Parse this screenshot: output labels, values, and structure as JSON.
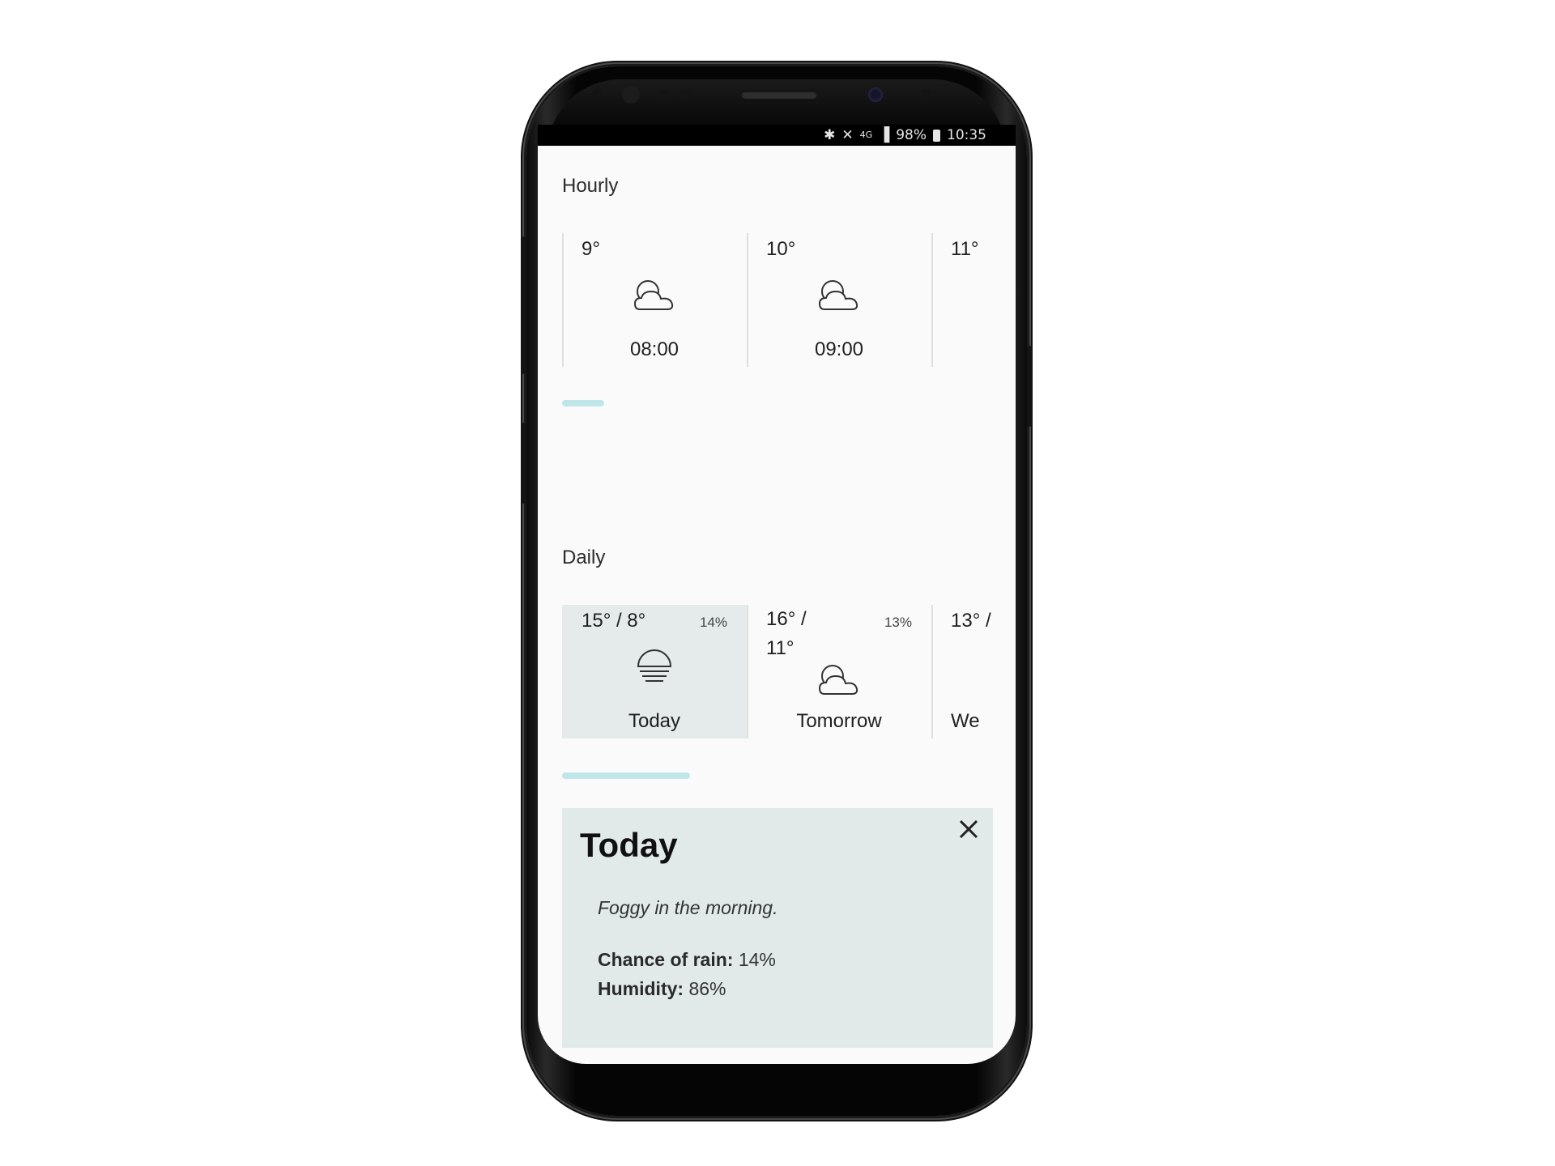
{
  "status_bar": {
    "icons": [
      "bluetooth-icon",
      "mute-icon",
      "4g-icon",
      "signal-icon"
    ],
    "battery": "98%",
    "time": "10:35"
  },
  "hourly": {
    "title": "Hourly",
    "items": [
      {
        "temp": "9°",
        "time": "08:00",
        "icon": "partly-cloudy-icon"
      },
      {
        "temp": "10°",
        "time": "09:00",
        "icon": "partly-cloudy-icon"
      },
      {
        "temp": "11°",
        "time": "",
        "icon": ""
      }
    ],
    "scroll_position": 0.0
  },
  "daily": {
    "title": "Daily",
    "items": [
      {
        "temp": "15° / 8°",
        "rain": "14%",
        "label": "Today",
        "icon": "fog-icon",
        "selected": true
      },
      {
        "temp": "16° /\n11°",
        "rain": "13%",
        "label": "Tomorrow",
        "icon": "partly-cloudy-icon",
        "selected": false
      },
      {
        "temp": "13° /",
        "rain": "",
        "label": "We",
        "icon": "",
        "selected": false
      }
    ]
  },
  "detail": {
    "title": "Today",
    "description": "Foggy in the morning.",
    "rain_label": "Chance of rain:",
    "rain_value": "14%",
    "humidity_label": "Humidity:",
    "humidity_value": "86%"
  },
  "colors": {
    "accent": "#bfe7ea",
    "selected_bg": "#e4ebea",
    "panel_bg": "#e1eae9",
    "app_bg": "#fafafa"
  }
}
